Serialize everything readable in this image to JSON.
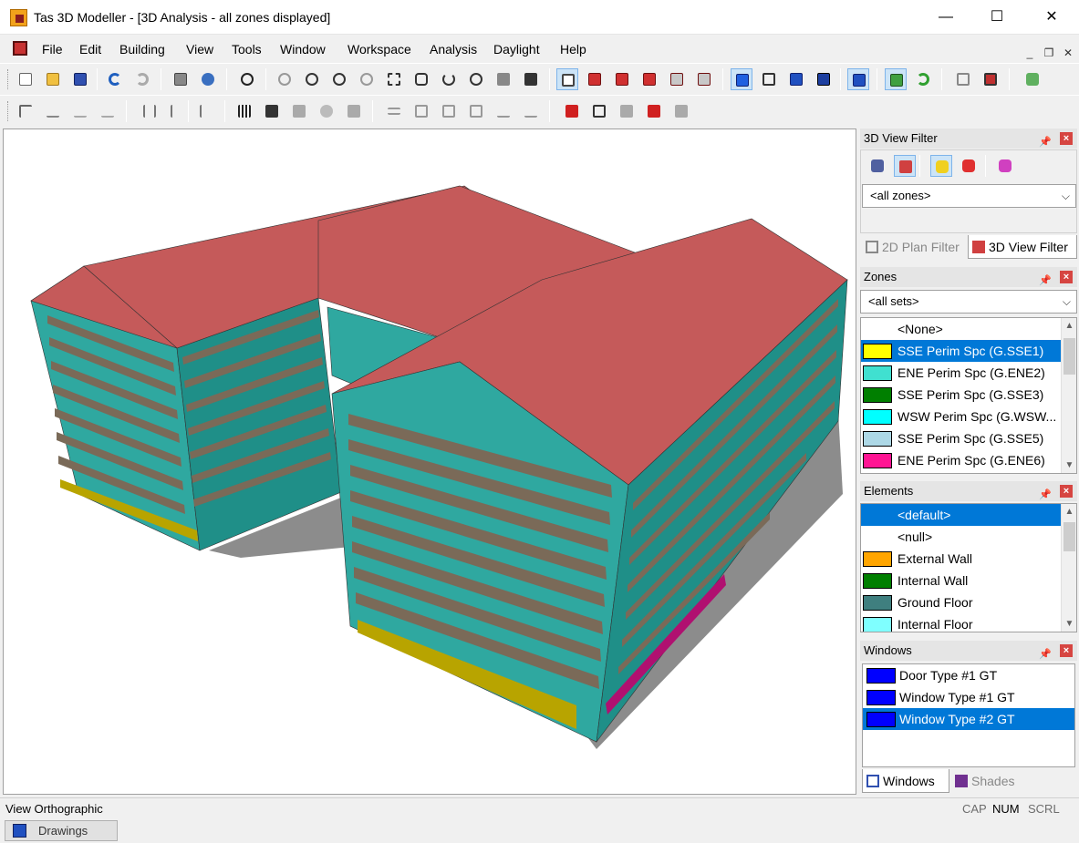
{
  "window": {
    "title": "Tas 3D Modeller - [3D Analysis - all zones displayed]",
    "minimize_glyph": "—",
    "maximize_glyph": "☐",
    "close_glyph": "✕"
  },
  "menu": {
    "items": [
      "File",
      "Edit",
      "Building",
      "View",
      "Tools",
      "Window",
      "Workspace",
      "Analysis",
      "Daylight",
      "Help"
    ],
    "mdi_minimize": "_",
    "mdi_restore": "❐",
    "mdi_close": "✕"
  },
  "view_filter_panel": {
    "title": "3D View Filter",
    "zone_filter_value": "<all zones>",
    "tabs": [
      "2D Plan Filter",
      "3D View Filter"
    ]
  },
  "zones_panel": {
    "title": "Zones",
    "set_value": "<all sets>",
    "items": [
      {
        "label": "<None>",
        "color": null
      },
      {
        "label": "SSE Perim Spc (G.SSE1)",
        "color": "#ffff00"
      },
      {
        "label": "ENE Perim Spc (G.ENE2)",
        "color": "#40e0d0"
      },
      {
        "label": "SSE Perim Spc (G.SSE3)",
        "color": "#007f00"
      },
      {
        "label": "WSW Perim Spc (G.WSW...",
        "color": "#00ffff"
      },
      {
        "label": "SSE Perim Spc (G.SSE5)",
        "color": "#add8e6"
      },
      {
        "label": "ENE Perim Spc (G.ENE6)",
        "color": "#ff1493"
      }
    ]
  },
  "elements_panel": {
    "title": "Elements",
    "items": [
      {
        "label": "<default>",
        "color": null
      },
      {
        "label": "<null>",
        "color": null
      },
      {
        "label": "External Wall",
        "color": "#ffa500"
      },
      {
        "label": "Internal Wall",
        "color": "#007f00"
      },
      {
        "label": "Ground Floor",
        "color": "#3f7f7f"
      },
      {
        "label": "Internal Floor",
        "color": "#7fffff"
      }
    ]
  },
  "windows_panel": {
    "title": "Windows",
    "items": [
      {
        "label": "Door Type #1 GT",
        "color": "#0000ff"
      },
      {
        "label": "Window Type #1 GT",
        "color": "#0000ff"
      },
      {
        "label": "Window Type #2 GT",
        "color": "#0000ff"
      }
    ],
    "tabs": [
      "Windows",
      "Shades"
    ]
  },
  "status": {
    "text": "View Orthographic",
    "indicators": [
      "CAP",
      "NUM",
      "SCRL"
    ]
  },
  "bottom_tab": "Drawings",
  "colors": {
    "roof": "#c55a5a",
    "wall": "#2fa8a0",
    "wall_dark": "#1f8f88",
    "window_band": "#7a6a58",
    "shadow": "#8c8c8c",
    "selection": "#0078d7"
  }
}
